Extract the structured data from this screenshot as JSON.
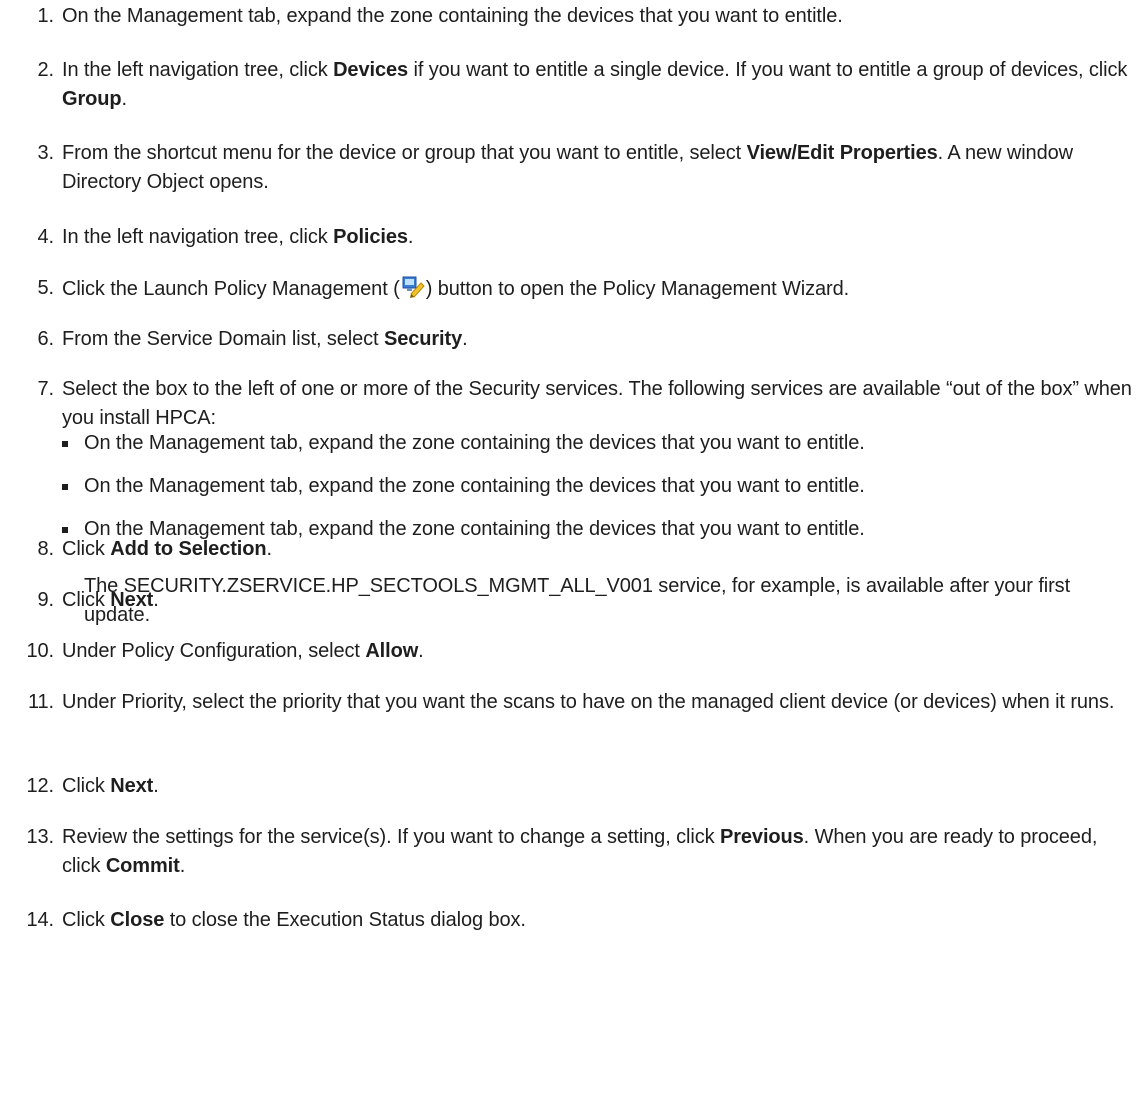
{
  "steps": [
    {
      "num": "1.",
      "parts": [
        {
          "t": "On the Management tab, expand the zone containing the devices that you want to entitle."
        }
      ]
    },
    {
      "num": "2.",
      "parts": [
        {
          "t": "In the left navigation tree, click "
        },
        {
          "t": "Devices",
          "b": true
        },
        {
          "t": " if you want to entitle a single device. If you want to entitle a group of devices, click "
        },
        {
          "t": "Group",
          "b": true
        },
        {
          "t": "."
        }
      ]
    },
    {
      "num": "3.",
      "parts": [
        {
          "t": "From the shortcut menu for the device or group that you want to entitle, select "
        },
        {
          "t": "View/Edit Properties",
          "b": true
        },
        {
          "t": ". A new window Directory Object opens."
        }
      ]
    },
    {
      "num": "4.",
      "parts": [
        {
          "t": "In the left navigation tree, click "
        },
        {
          "t": "Policies",
          "b": true
        },
        {
          "t": "."
        }
      ]
    },
    {
      "num": "5.",
      "parts": [
        {
          "t": "Click the Launch Policy Management ("
        },
        {
          "icon": "launch-policy-icon"
        },
        {
          "t": ") button to open the Policy Management Wizard."
        }
      ]
    },
    {
      "num": "6.",
      "parts": [
        {
          "t": "From the Service Domain list, select "
        },
        {
          "t": "Security",
          "b": true
        },
        {
          "t": "."
        }
      ]
    },
    {
      "num": "7.",
      "parts": [
        {
          "t": "Select the box to the left of one or more of the Security services. The following services are available “out of the box” when you install HPCA:"
        }
      ]
    },
    {
      "num": "8.",
      "parts": [
        {
          "t": "Click "
        },
        {
          "t": "Add to Selection",
          "b": true
        },
        {
          "t": "."
        }
      ]
    },
    {
      "num": "9.",
      "parts": [
        {
          "t": "Click "
        },
        {
          "t": "Next",
          "b": true
        },
        {
          "t": "."
        }
      ]
    },
    {
      "num": "10.",
      "parts": [
        {
          "t": "Under Policy Configuration, select "
        },
        {
          "t": "Allow",
          "b": true
        },
        {
          "t": "."
        }
      ]
    },
    {
      "num": "11.",
      "parts": [
        {
          "t": "Under Priority, select the priority that you want the scans to have on the managed client device (or devices) when it runs."
        }
      ]
    },
    {
      "num": "12.",
      "parts": [
        {
          "t": "Click "
        },
        {
          "t": "Next",
          "b": true
        },
        {
          "t": "."
        }
      ]
    },
    {
      "num": "13.",
      "parts": [
        {
          "t": "Review the settings for the service(s). If you want to change a setting, click "
        },
        {
          "t": "Previous",
          "b": true
        },
        {
          "t": ". When you are ready to proceed, click "
        },
        {
          "t": "Commit",
          "b": true
        },
        {
          "t": "."
        }
      ]
    },
    {
      "num": "14.",
      "parts": [
        {
          "t": "Click "
        },
        {
          "t": "Close",
          "b": true
        },
        {
          "t": " to close the Execution Status dialog box."
        }
      ]
    }
  ],
  "step7_bullets": [
    "On the Management tab, expand the zone containing the devices that you want to entitle.",
    "On the Management tab, expand the zone containing the devices that you want to entitle.",
    "On the Management tab, expand the zone containing the devices that you want to entitle."
  ],
  "step7_note": "The SECURITY.ZSERVICE.HP_SECTOOLS_MGMT_ALL_V001 service, for example, is available after your first update."
}
